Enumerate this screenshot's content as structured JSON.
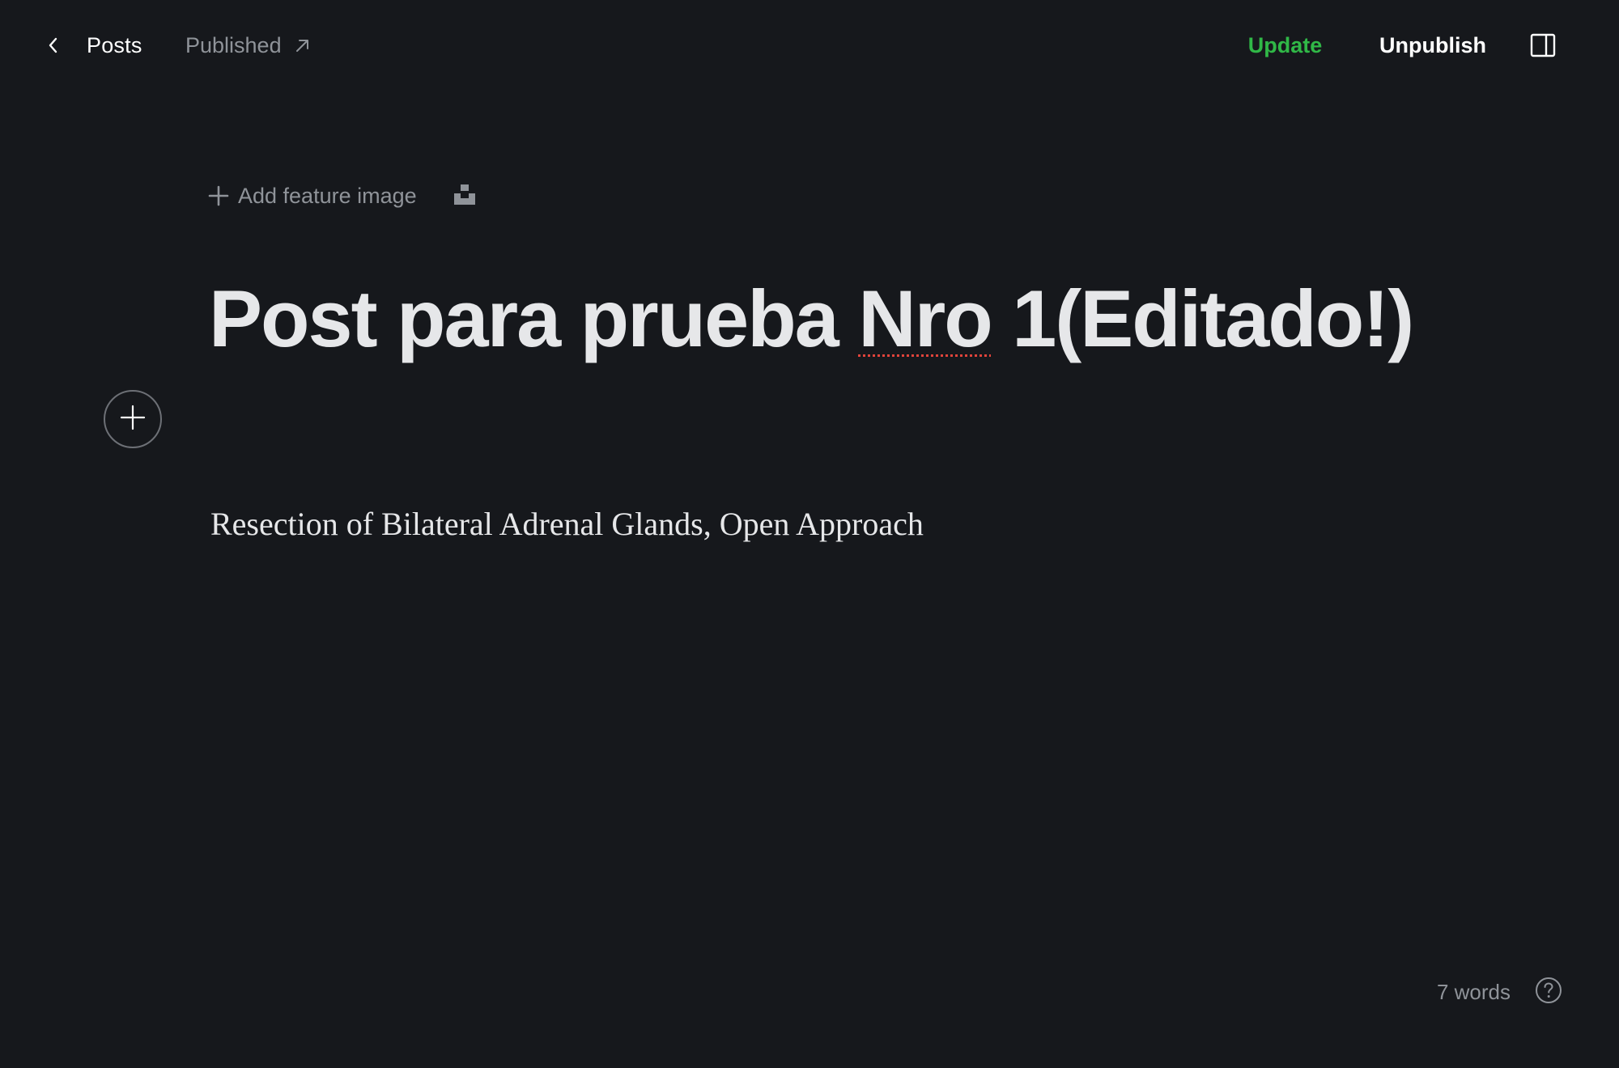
{
  "header": {
    "back_icon": "chevron-left-icon",
    "back_label": "Posts",
    "status_label": "Published",
    "status_icon": "arrow-up-right-icon",
    "update_label": "Update",
    "unpublish_label": "Unpublish",
    "sidebar_toggle_icon": "sidebar-panel-icon"
  },
  "editor": {
    "add_feature_label": "Add feature image",
    "add_feature_icon": "plus-icon",
    "unsplash_icon": "unsplash-icon",
    "title_before": "Post para prueba ",
    "title_misspelled": "Nro",
    "title_after": " 1(Editado!)",
    "card_menu_icon": "plus-circle-icon",
    "body": "Resection of Bilateral Adrenal Glands, Open Approach"
  },
  "footer": {
    "word_count": "7 words",
    "help_icon": "question-circle-icon"
  },
  "colors": {
    "background": "#16181c",
    "accent_green": "#30b847",
    "text_primary": "#e6e7e9",
    "text_muted": "#8f9399",
    "spellcheck_red": "#e0443b"
  }
}
